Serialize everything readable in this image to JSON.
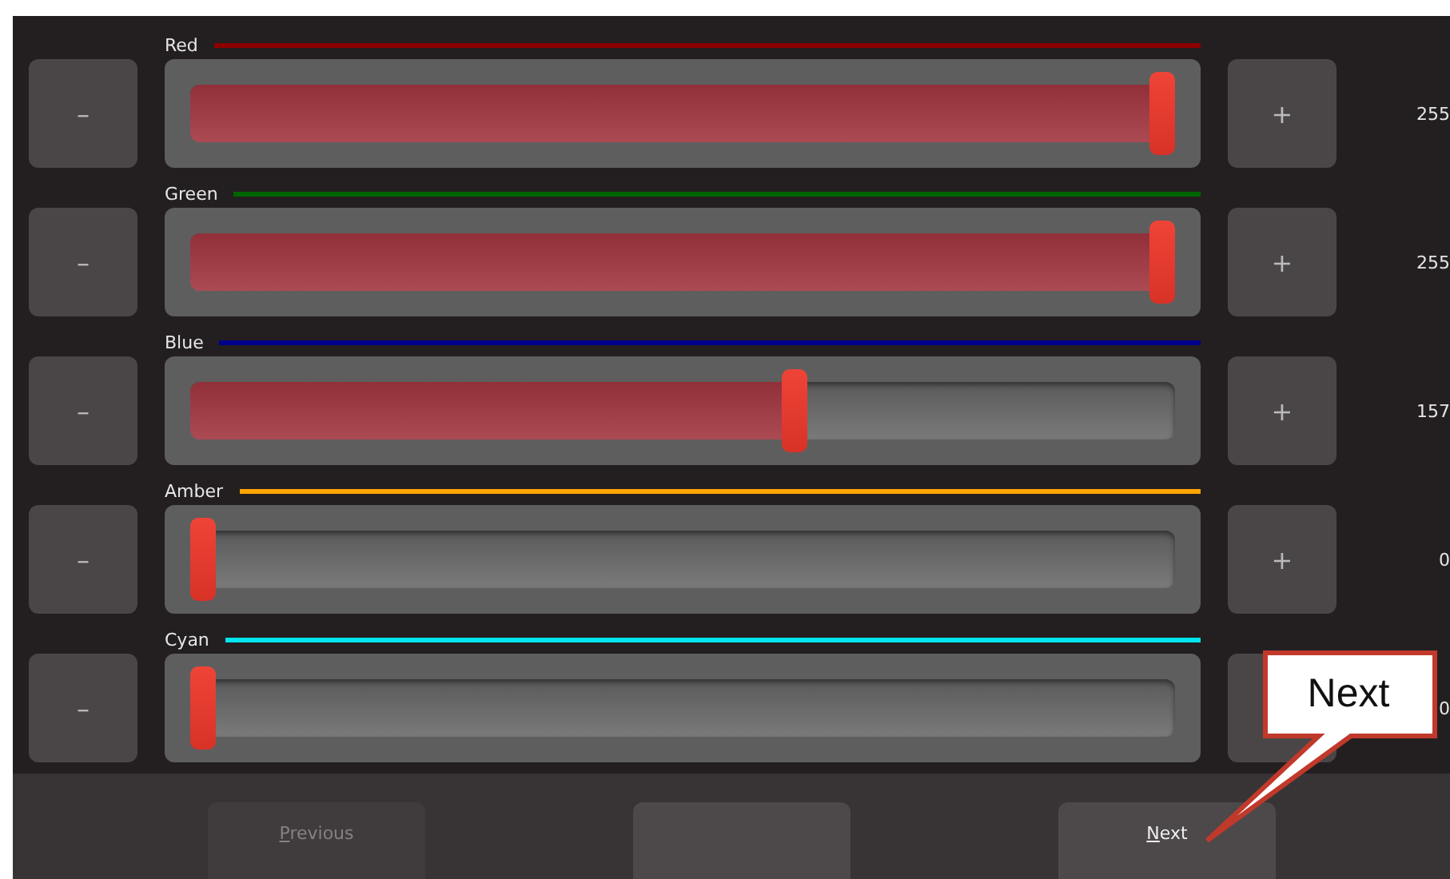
{
  "channels": [
    {
      "name": "Red",
      "color": "#8b0000",
      "level": 1,
      "minus": "–",
      "plus": "+",
      "value": "255"
    },
    {
      "name": "Green",
      "color": "#006400",
      "level": 1,
      "minus": "–",
      "plus": "+",
      "value": "255"
    },
    {
      "name": "Blue",
      "color": "#00008b",
      "level": 0.616,
      "minus": "–",
      "plus": "+",
      "value": "157"
    },
    {
      "name": "Amber",
      "color": "#ffa500",
      "level": 0,
      "minus": "–",
      "plus": "+",
      "value": "0"
    },
    {
      "name": "Cyan",
      "color": "#00e5ee",
      "level": 0,
      "minus": "–",
      "value": "0"
    }
  ],
  "buttons": [
    {
      "label": "Previous",
      "disabled": true
    },
    {
      "disabled": false
    },
    {
      "label": "Next",
      "disabled": false
    }
  ],
  "callout": {
    "text": "Next"
  }
}
